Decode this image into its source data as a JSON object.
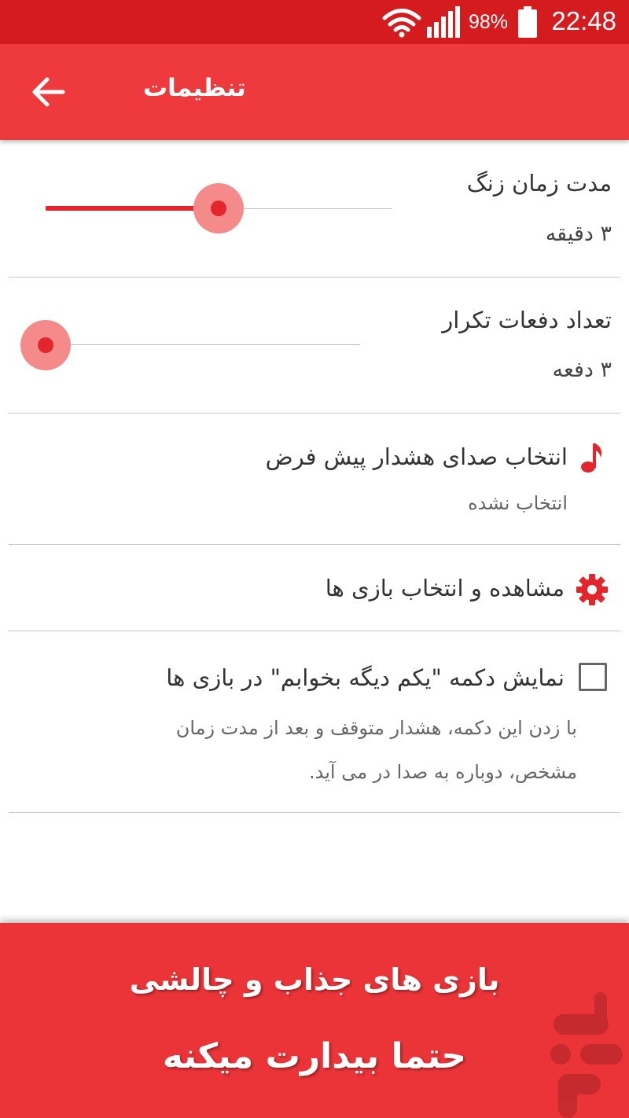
{
  "status_bar": {
    "time": "22:48",
    "battery_percent": "98%",
    "icons": [
      "wifi-icon",
      "signal-icon",
      "battery-icon"
    ]
  },
  "toolbar": {
    "title": "تنظیمات",
    "back_icon": "arrow-left-icon"
  },
  "settings": {
    "ring_duration": {
      "title": "مدت زمان زنگ",
      "value": "۳ دقیقه",
      "slider_fraction": 0.5
    },
    "repeat_count": {
      "title": "تعداد دفعات تکرار",
      "value": "۳ دفعه",
      "slider_fraction": 0.0
    },
    "alarm_sound": {
      "title": "انتخاب صدای هشدار پیش فرض",
      "value": "انتخاب نشده",
      "icon": "music-note-icon"
    },
    "games": {
      "title": "مشاهده و انتخاب بازی ها",
      "icon": "gear-icon"
    },
    "snooze_button": {
      "title": "نمایش دکمه \"یکم دیگه بخوابم\" در بازی ها",
      "checked": false,
      "description_line1": "با زدن این دکمه، هشدار متوقف و بعد از مدت زمان",
      "description_line2": "مشخص، دوباره به صدا در می آید."
    }
  },
  "banner": {
    "line1": "بازی های جذاب و چالشی",
    "line2": "حتما بیدارت میکنه",
    "logo": "store-logo-icon"
  },
  "colors": {
    "status_bar": "#d41c1f",
    "toolbar": "#ef3a3d",
    "accent": "#e2262b",
    "banner": "#ea3438"
  }
}
